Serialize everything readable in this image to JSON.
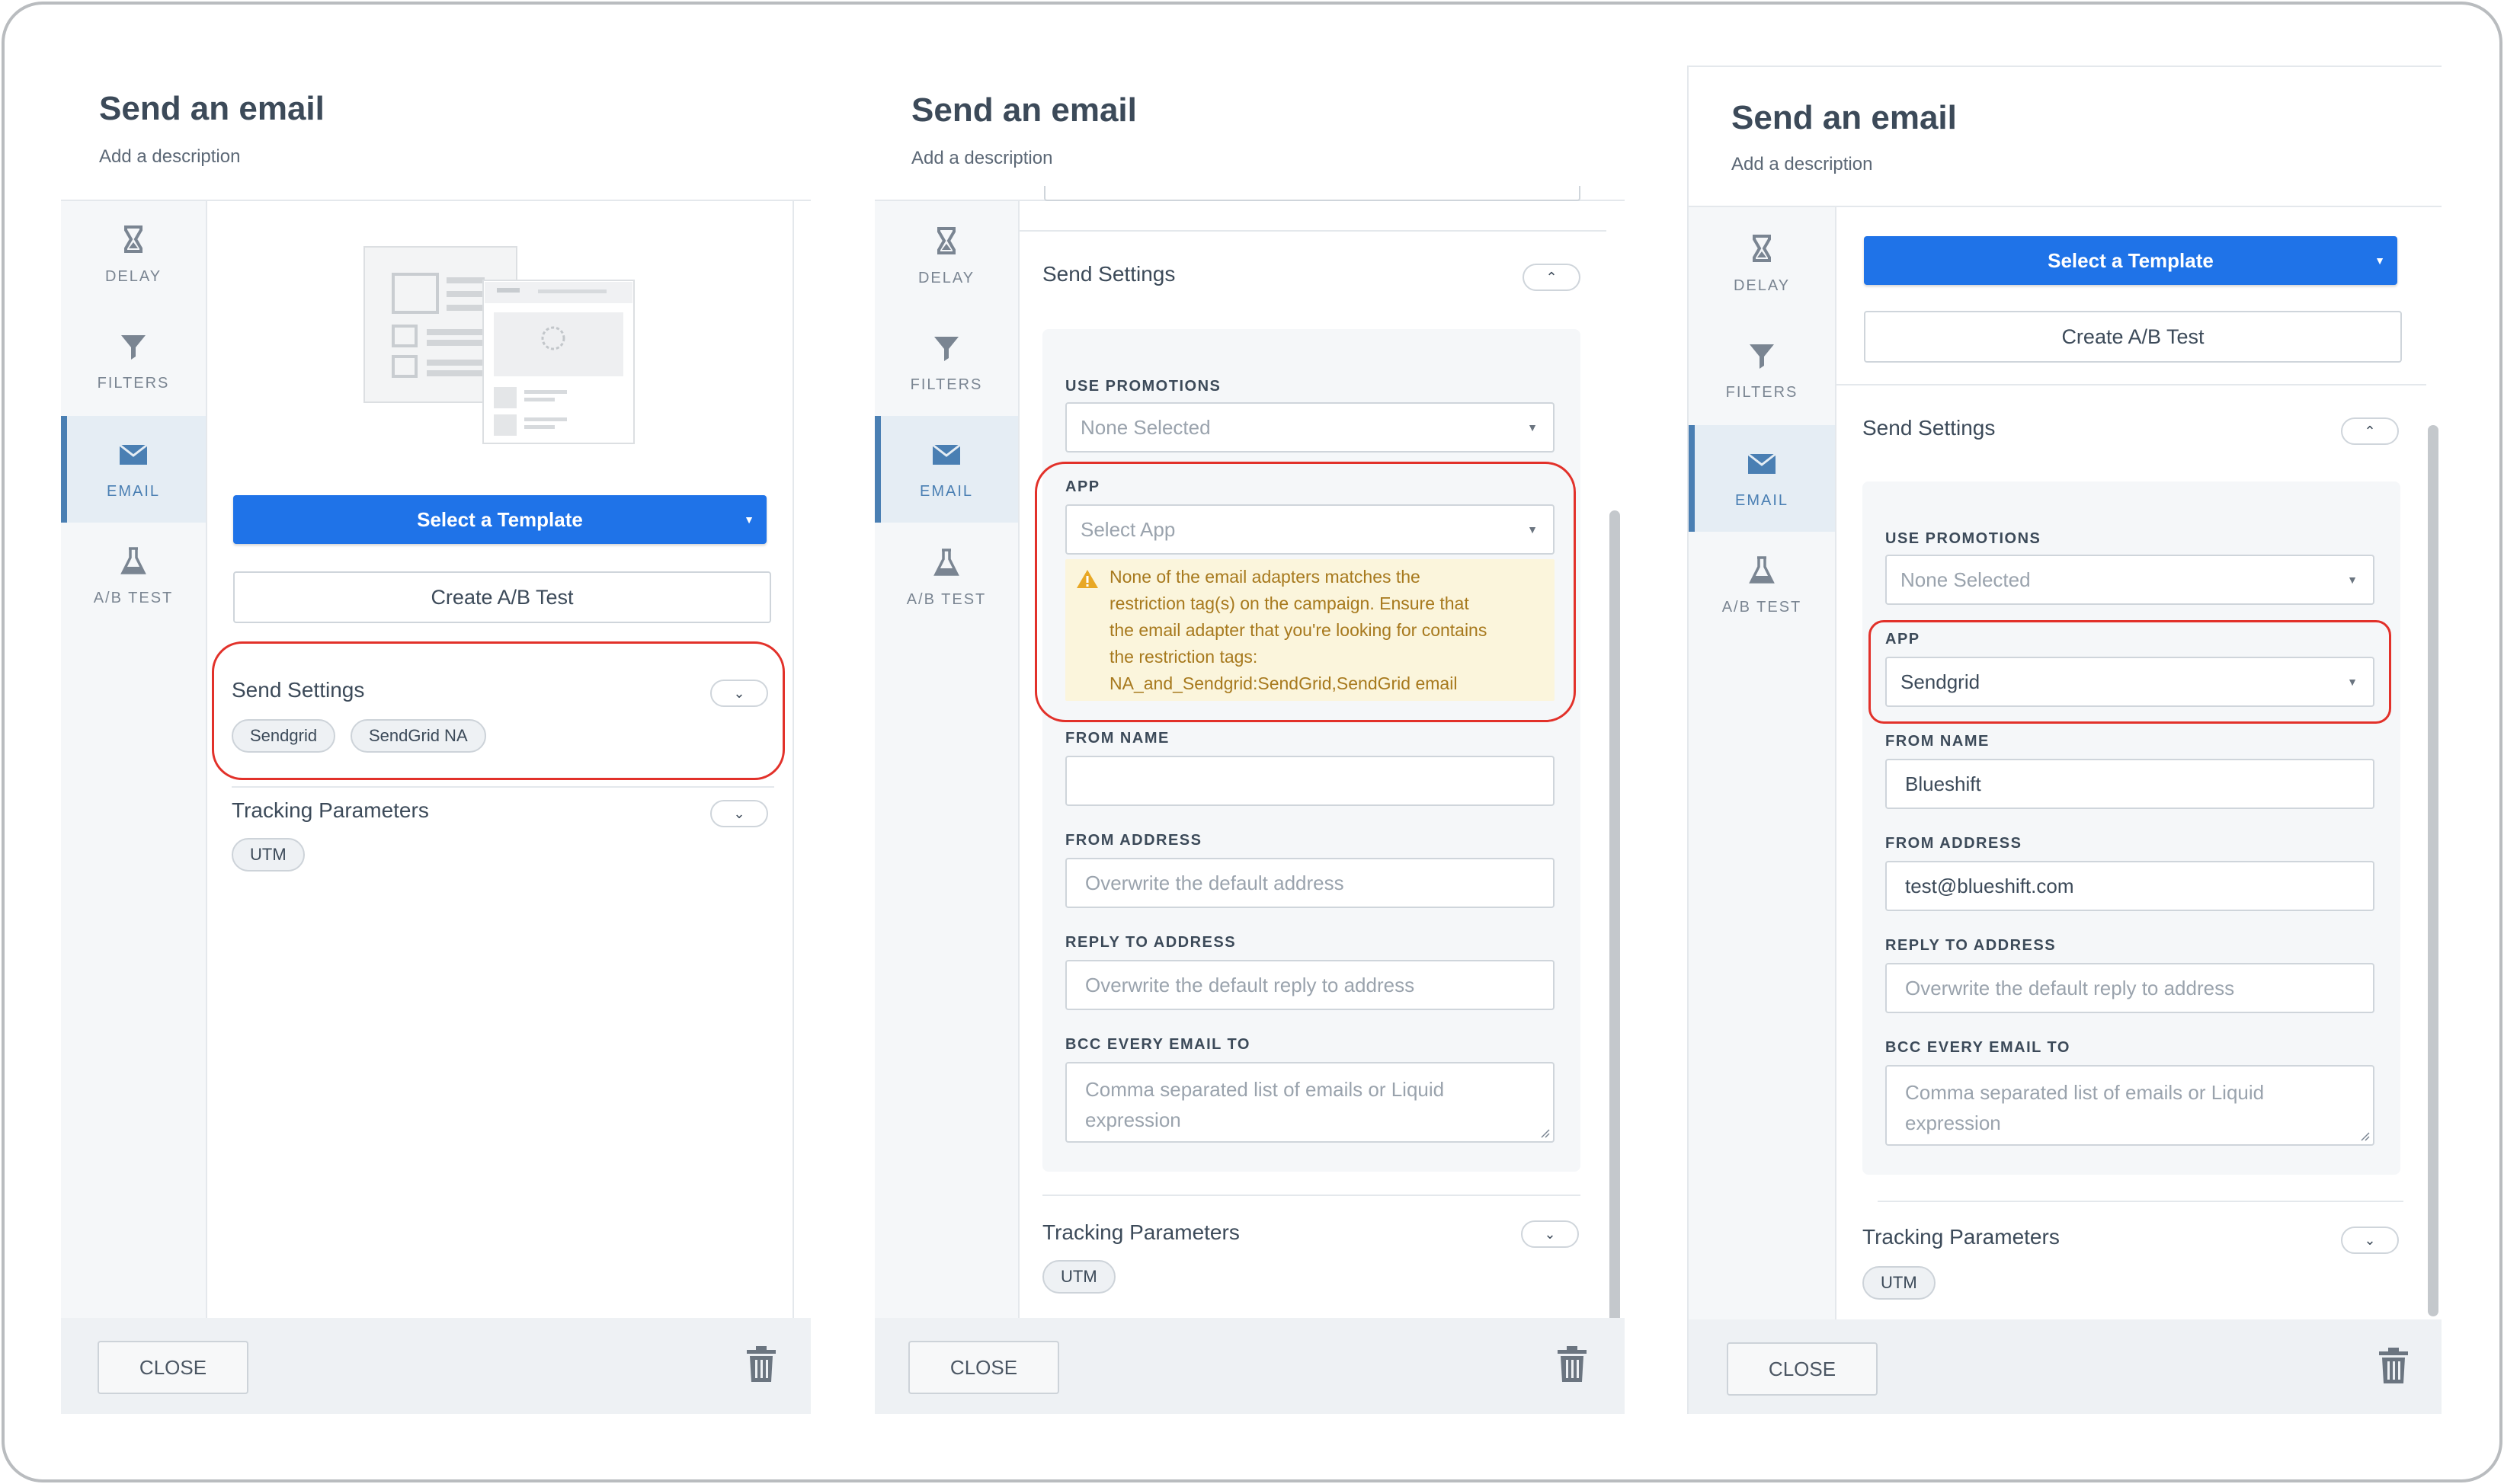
{
  "panel": {
    "title": "Send an email",
    "description": "Add a description"
  },
  "sidebar": {
    "items": [
      {
        "label": "DELAY",
        "icon": "hourglass-icon"
      },
      {
        "label": "FILTERS",
        "icon": "filter-icon"
      },
      {
        "label": "EMAIL",
        "icon": "envelope-icon"
      },
      {
        "label": "A/B TEST",
        "icon": "flask-icon"
      }
    ],
    "active": "EMAIL"
  },
  "buttons": {
    "select_template": "Select a Template",
    "create_ab_test": "Create A/B Test",
    "close": "CLOSE"
  },
  "sections": {
    "send_settings": "Send Settings",
    "tracking_parameters": "Tracking Parameters"
  },
  "chips": {
    "send_settings": [
      "Sendgrid",
      "SendGrid NA"
    ],
    "tracking": [
      "UTM"
    ]
  },
  "fields": {
    "use_promotions": "USE PROMOTIONS",
    "app": "APP",
    "from_name": "FROM NAME",
    "from_address": "FROM ADDRESS",
    "reply_to_address": "REPLY TO ADDRESS",
    "bcc_every_email_to": "BCC EVERY EMAIL TO"
  },
  "placeholders": {
    "none_selected": "None Selected",
    "select_app": "Select App",
    "from_address": "Overwrite the default address",
    "reply_to_address": "Overwrite the default reply to address",
    "bcc": "Comma separated list of emails or Liquid expression"
  },
  "values": {
    "app": "Sendgrid",
    "from_name": "Blueshift",
    "from_address": "test@blueshift.com"
  },
  "warning": {
    "line1": "None of the email adapters matches the",
    "line2": "restriction tag(s) on the campaign. Ensure that",
    "line3": "the email adapter that you're looking for contains",
    "line4": "the restriction tags:",
    "line5": "NA_and_Sendgrid:SendGrid,SendGrid email"
  },
  "colors": {
    "primary": "#1f73e8",
    "active_accent": "#4a7fb3",
    "highlight": "#e2312a",
    "warning_bg": "#fbf5dc",
    "warning_text": "#a7791d"
  }
}
